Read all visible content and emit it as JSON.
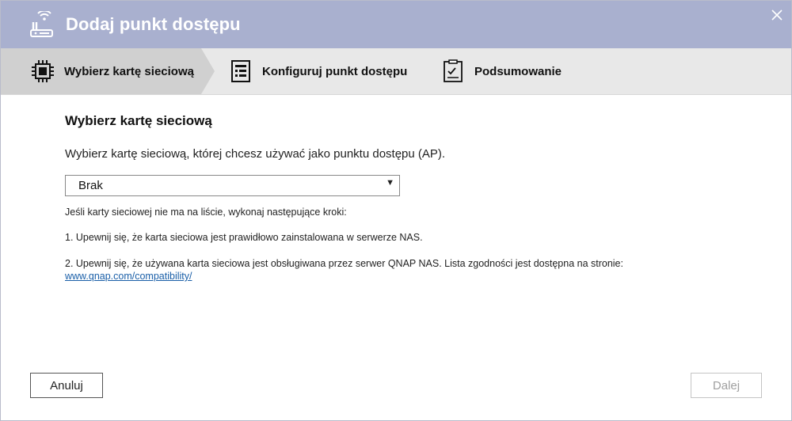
{
  "dialog": {
    "title": "Dodaj punkt dostępu",
    "title_icon": "router-icon",
    "close_icon": "close-icon"
  },
  "steps": [
    {
      "label": "Wybierz kartę sieciową",
      "icon": "network-card-icon",
      "active": true
    },
    {
      "label": "Konfiguruj punkt dostępu",
      "icon": "form-icon",
      "active": false
    },
    {
      "label": "Podsumowanie",
      "icon": "checklist-icon",
      "active": false
    }
  ],
  "main": {
    "heading": "Wybierz kartę sieciową",
    "description": "Wybierz kartę sieciową, której chcesz używać jako punktu dostępu (AP).",
    "select": {
      "value": "Brak"
    },
    "note_intro": "Jeśli karty sieciowej nie ma na liście, wykonaj następujące kroki:",
    "note_step1": "1. Upewnij się, że karta sieciowa jest prawidłowo zainstalowana w serwerze NAS.",
    "note_step2": "2. Upewnij się, że używana karta sieciowa jest obsługiwana przez serwer QNAP NAS. Lista zgodności jest dostępna na stronie:",
    "link": "www.qnap.com/compatibility/"
  },
  "footer": {
    "cancel_label": "Anuluj",
    "next_label": "Dalej"
  },
  "colors": {
    "titlebar": "#a9b0cf",
    "stepbar": "#e8e8e8",
    "active_step": "#d0d0d0",
    "link": "#1a5fa8"
  }
}
